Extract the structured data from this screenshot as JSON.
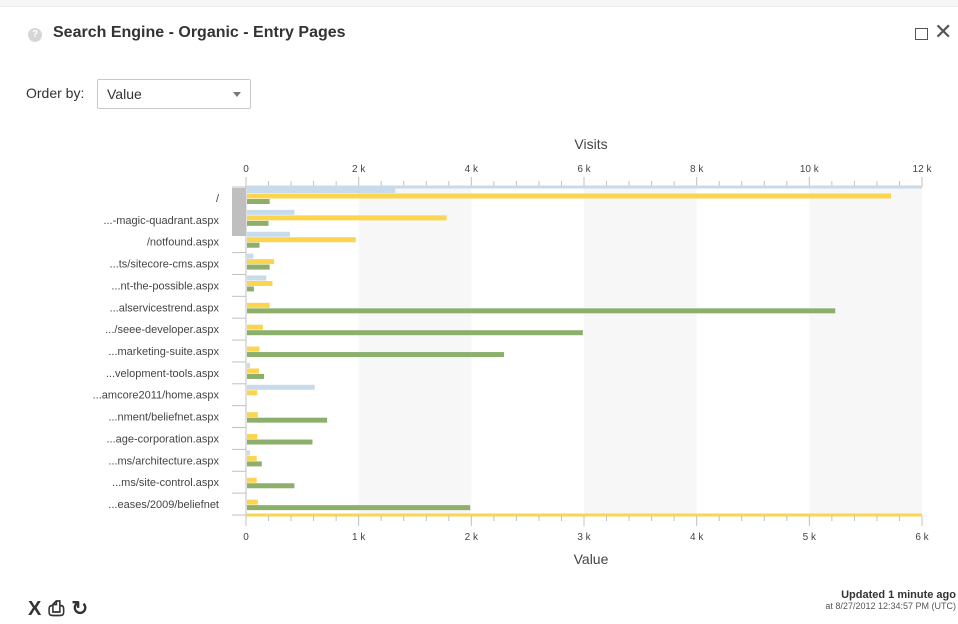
{
  "header": {
    "help_icon_text": "?",
    "title": "Search Engine - Organic - Entry Pages"
  },
  "controls": {
    "order_label": "Order by:",
    "order_value": "Value"
  },
  "chart_data": {
    "type": "bar",
    "top_axis_title": "Visits",
    "bottom_axis_title": "Value",
    "top_axis_range": [
      0,
      12000
    ],
    "top_ticks": [
      "0",
      "2 k",
      "4 k",
      "6 k",
      "8 k",
      "10 k",
      "12 k"
    ],
    "bottom_axis_range": [
      0,
      6000
    ],
    "bottom_ticks": [
      "0",
      "1 k",
      "2 k",
      "3 k",
      "4 k",
      "5 k",
      "6 k"
    ],
    "categories": [
      "/",
      "...-magic-quadrant.aspx",
      "/notfound.aspx",
      "...ts/sitecore-cms.aspx",
      "...nt-the-possible.aspx",
      "...alservicestrend.aspx",
      ".../seee-developer.aspx",
      "...marketing-suite.aspx",
      "...velopment-tools.aspx",
      "...amcore2011/home.aspx",
      "...nment/beliefnet.aspx",
      "...age-corporation.aspx",
      "...ms/architecture.aspx",
      "...ms/site-control.aspx",
      "...eases/2009/beliefnet"
    ],
    "series": [
      {
        "axis": "top",
        "color": "#c8dbeb",
        "values": [
          2650,
          860,
          780,
          130,
          360,
          0,
          0,
          0,
          70,
          1220,
          0,
          0,
          70,
          0,
          0
        ]
      },
      {
        "axis": "top",
        "color": "#fcd54f",
        "values": [
          11450,
          3560,
          1950,
          500,
          470,
          420,
          300,
          240,
          230,
          200,
          210,
          200,
          190,
          190,
          210
        ]
      },
      {
        "axis": "bottom",
        "color": "#8cb06b",
        "values": [
          210,
          200,
          120,
          210,
          70,
          5230,
          2990,
          2290,
          160,
          0,
          720,
          590,
          140,
          430,
          1990
        ]
      }
    ],
    "colors": {
      "scroll_thumb": "#bfbfbf",
      "band": "#f7f7f7",
      "axis": "#c0c0c0",
      "axis_accent": "#fcd54f"
    }
  },
  "footer": {
    "excel_icon": "X",
    "report_icon": "⎙",
    "refresh_icon": "↻",
    "updated_label": "Updated 1 minute ago",
    "updated_time": "at 8/27/2012 12:34:57 PM (UTC)"
  }
}
